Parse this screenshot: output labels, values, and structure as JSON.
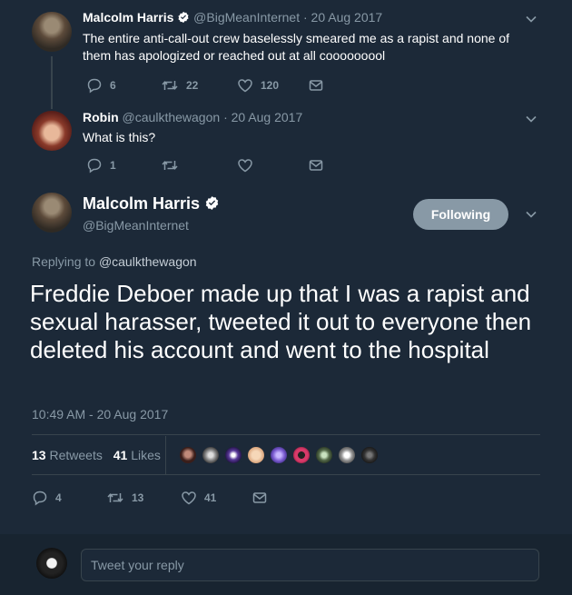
{
  "tweets": [
    {
      "name": "Malcolm Harris",
      "handle": "@BigMeanInternet",
      "date": "· 20 Aug 2017",
      "text": "The entire anti-call-out crew baselessly smeared me as a rapist and none of them has apologized or reached out at all cooooooool",
      "replies": "6",
      "retweets": "22",
      "likes": "120"
    },
    {
      "name": "Robin",
      "handle": "@caulkthewagon",
      "date": "· 20 Aug 2017",
      "text": "What is this?",
      "replies": "1",
      "retweets": "",
      "likes": ""
    }
  ],
  "main": {
    "name": "Malcolm Harris",
    "handle": "@BigMeanInternet",
    "follow_label": "Following",
    "replying_prefix": "Replying to",
    "replying_handle": "@caulkthewagon",
    "text": "Freddie Deboer made up that I was a rapist and sexual harasser, tweeted it out to everyone then deleted his account and went to the hospital",
    "timestamp": "10:49 AM - 20 Aug 2017",
    "stats": {
      "retweets_count": "13",
      "retweets_label": "Retweets",
      "likes_count": "41",
      "likes_label": "Likes"
    },
    "actions": {
      "replies": "4",
      "retweets": "13",
      "likes": "41"
    }
  },
  "reply_box": {
    "placeholder": "Tweet your reply"
  },
  "colors": {
    "background": "#1c2938",
    "muted": "#8899a6",
    "divider": "#38444d",
    "button": "#8899a6"
  },
  "icons": [
    "verified-icon",
    "chevron-down-icon",
    "reply-icon",
    "retweet-icon",
    "like-icon",
    "dm-icon"
  ]
}
